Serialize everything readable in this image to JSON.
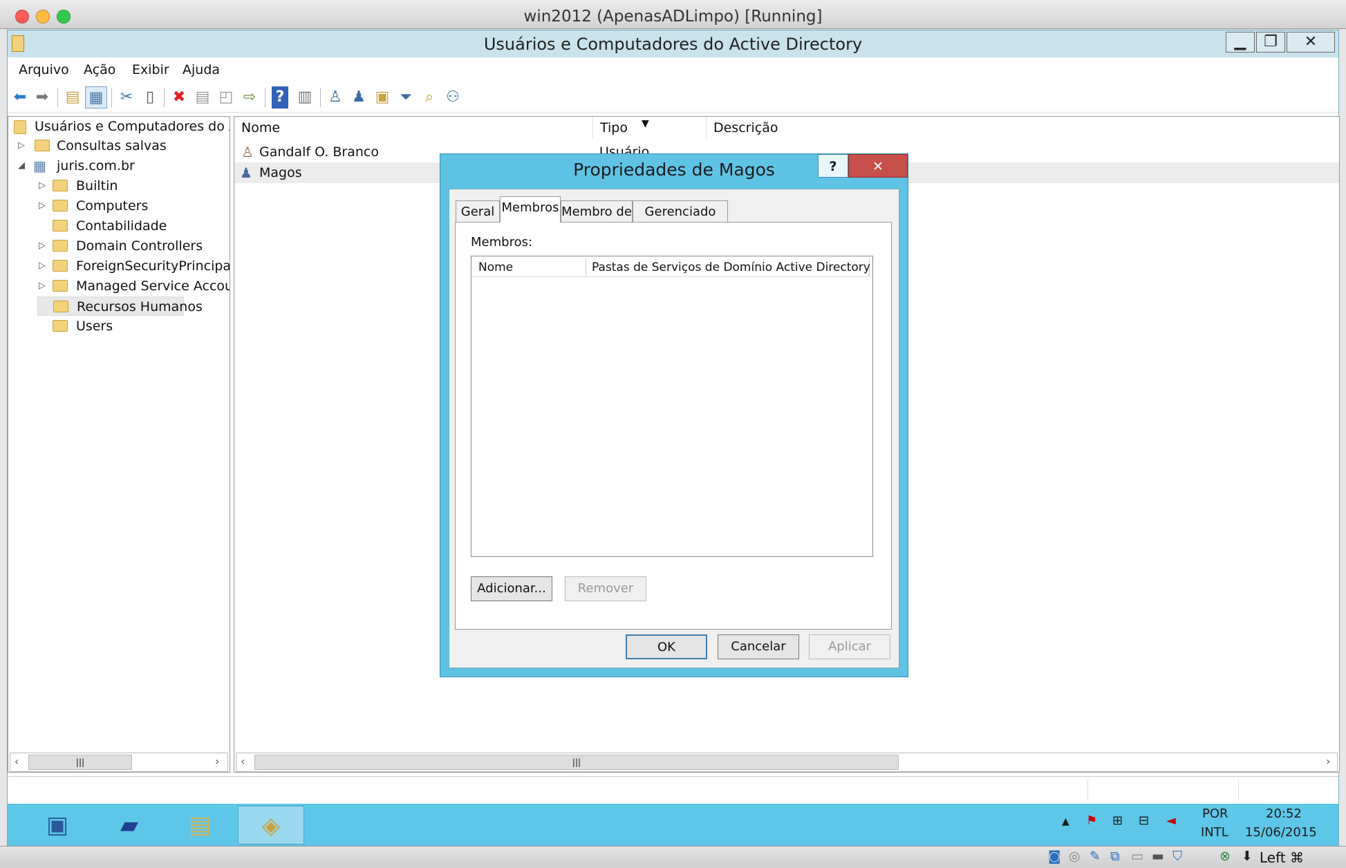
{
  "vbox": {
    "title": "win2012 (ApenasADLimpo) [Running]",
    "hostkey": "Left ⌘"
  },
  "window": {
    "title": "Usuários e Computadores do Active Directory",
    "min": "▁",
    "max": "❐",
    "close": "✕"
  },
  "menu": [
    "Arquivo",
    "Ação",
    "Exibir",
    "Ajuda"
  ],
  "tree": {
    "root": "Usuários e Computadores do Ac",
    "items": [
      "Consultas salvas",
      "juris.com.br",
      "Builtin",
      "Computers",
      "Contabilidade",
      "Domain Controllers",
      "ForeignSecurityPrincipals",
      "Managed Service Accour",
      "Recursos Humanos",
      "Users"
    ]
  },
  "list": {
    "columns": [
      "Nome",
      "Tipo",
      "Descrição"
    ],
    "rows": [
      {
        "name": "Gandalf O. Branco",
        "type": "Usuário"
      },
      {
        "name": "Magos",
        "type": ""
      }
    ]
  },
  "dialog": {
    "title": "Propriedades de Magos",
    "help": "?",
    "close": "✕",
    "tabs": [
      "Geral",
      "Membros",
      "Membro de",
      "Gerenciado por"
    ],
    "members_label": "Membros:",
    "columns": [
      "Nome",
      "Pastas de Serviços de Domínio Active Directory"
    ],
    "add": "Adicionar...",
    "remove": "Remover",
    "ok": "OK",
    "cancel": "Cancelar",
    "apply": "Aplicar"
  },
  "tray": {
    "lang1": "POR",
    "lang2": "INTL",
    "time": "20:52",
    "date": "15/06/2015"
  }
}
